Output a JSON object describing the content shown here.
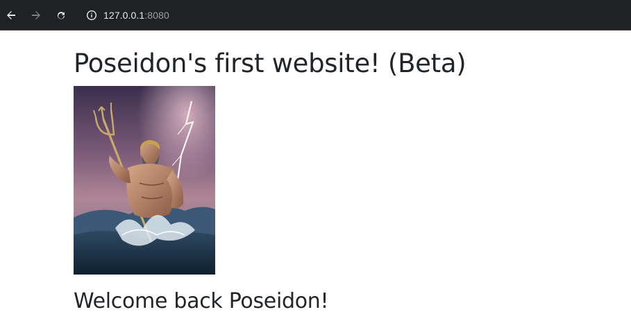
{
  "browser": {
    "url_host": "127.0.0.1",
    "url_port": ":8080",
    "icons": {
      "back": "arrow-left-icon",
      "forward": "arrow-right-icon",
      "reload": "reload-icon",
      "site_info": "info-icon"
    }
  },
  "page": {
    "heading": "Poseidon's first website! (Beta)",
    "welcome": "Welcome back Poseidon!"
  },
  "colors": {
    "toolbar_bg": "#202124",
    "text": "#212529"
  }
}
